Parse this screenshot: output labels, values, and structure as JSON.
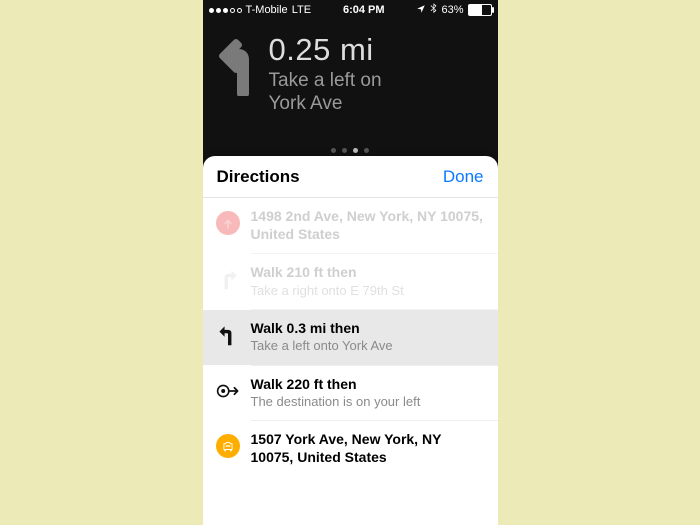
{
  "status": {
    "carrier": "T-Mobile",
    "network": "LTE",
    "time": "6:04 PM",
    "battery_pct": "63%"
  },
  "nav": {
    "distance": "0.25 mi",
    "instruction_line1": "Take a left on",
    "instruction_line2": "York Ave",
    "page_index": 2,
    "page_count": 4
  },
  "sheet": {
    "title": "Directions",
    "done_label": "Done"
  },
  "steps": [
    {
      "icon": "origin",
      "primary": "1498 2nd Ave, New York, NY 10075, United States",
      "secondary": "",
      "state": "faded"
    },
    {
      "icon": "turn-right",
      "primary": "Walk 210 ft then",
      "secondary": "Take a right onto E 79th St",
      "state": "faded"
    },
    {
      "icon": "turn-left",
      "primary": "Walk 0.3 mi then",
      "secondary": "Take a left onto York Ave",
      "state": "current"
    },
    {
      "icon": "arrive",
      "primary": "Walk 220 ft then",
      "secondary": "The destination is on your left",
      "state": "normal"
    },
    {
      "icon": "destination",
      "primary": "1507 York Ave, New York, NY 10075, United States",
      "secondary": "",
      "state": "normal"
    }
  ]
}
